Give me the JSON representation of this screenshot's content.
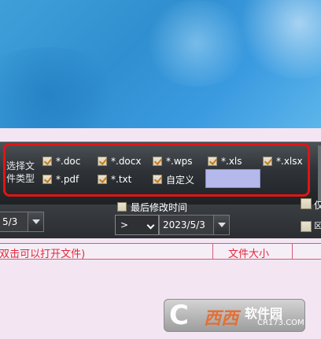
{
  "file_types": {
    "label_line1": "选择文",
    "label_line2": "件类型",
    "row1": [
      {
        "label": "*.doc",
        "checked": true
      },
      {
        "label": "*.docx",
        "checked": true
      },
      {
        "label": "*.wps",
        "checked": true
      },
      {
        "label": "*.xls",
        "checked": true
      },
      {
        "label": "*.xlsx",
        "checked": true
      }
    ],
    "row2": [
      {
        "label": "*.pdf",
        "checked": true
      },
      {
        "label": "*.txt",
        "checked": true
      },
      {
        "label": "自定义",
        "checked": true
      }
    ],
    "custom_value": ""
  },
  "filter": {
    "last_modified_label": "最后修改时间",
    "date_left": "5/3",
    "operator": ">",
    "date_right": "2023/5/3",
    "side_label_top": "仅",
    "side_label_bottom": "☒"
  },
  "grid": {
    "col_name": "(双击可以打开文件)",
    "col_size": "文件大小"
  },
  "watermark": {
    "logo_letter": "C",
    "logo_word": "西西",
    "site_name": "软件园",
    "domain": "CR173.COM"
  },
  "colors": {
    "highlight_border": "#e11414",
    "grid_header_text": "#e2283b",
    "custom_input_bg": "#b4b8ea"
  }
}
